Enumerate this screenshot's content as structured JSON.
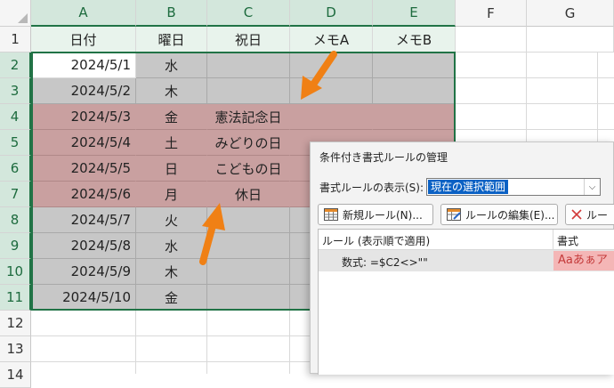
{
  "sheet": {
    "columns": [
      "A",
      "B",
      "C",
      "D",
      "E",
      "F",
      "G"
    ],
    "rows": [
      "1",
      "2",
      "3",
      "4",
      "5",
      "6",
      "7",
      "8",
      "9",
      "10",
      "11",
      "12",
      "13",
      "14"
    ],
    "headers": [
      "日付",
      "曜日",
      "祝日",
      "メモA",
      "メモB"
    ],
    "data": [
      {
        "date": "2024/5/1",
        "day": "水",
        "holiday": ""
      },
      {
        "date": "2024/5/2",
        "day": "木",
        "holiday": ""
      },
      {
        "date": "2024/5/3",
        "day": "金",
        "holiday": "憲法記念日"
      },
      {
        "date": "2024/5/4",
        "day": "土",
        "holiday": "みどりの日"
      },
      {
        "date": "2024/5/5",
        "day": "日",
        "holiday": "こどもの日"
      },
      {
        "date": "2024/5/6",
        "day": "月",
        "holiday": "休日"
      },
      {
        "date": "2024/5/7",
        "day": "火",
        "holiday": ""
      },
      {
        "date": "2024/5/8",
        "day": "水",
        "holiday": ""
      },
      {
        "date": "2024/5/9",
        "day": "木",
        "holiday": ""
      },
      {
        "date": "2024/5/10",
        "day": "金",
        "holiday": ""
      }
    ],
    "colors": {
      "gray_fill": "#c7c7c7",
      "pink_fill": "#c9a0a0",
      "selection": "#217346",
      "arrow": "#f08015"
    }
  },
  "dialog": {
    "title": "条件付き書式ルールの管理",
    "show_label": "書式ルールの表示(S):",
    "show_value": "現在の選択範囲",
    "new_rule": "新規ルール(N)...",
    "edit_rule": "ルールの編集(E)...",
    "delete_rule": "ルー",
    "col_rule": "ルール (表示順で適用)",
    "col_format": "書式",
    "rule_formula": "数式: =$C2<>\"\"",
    "rule_preview": "Aaあぁア"
  }
}
